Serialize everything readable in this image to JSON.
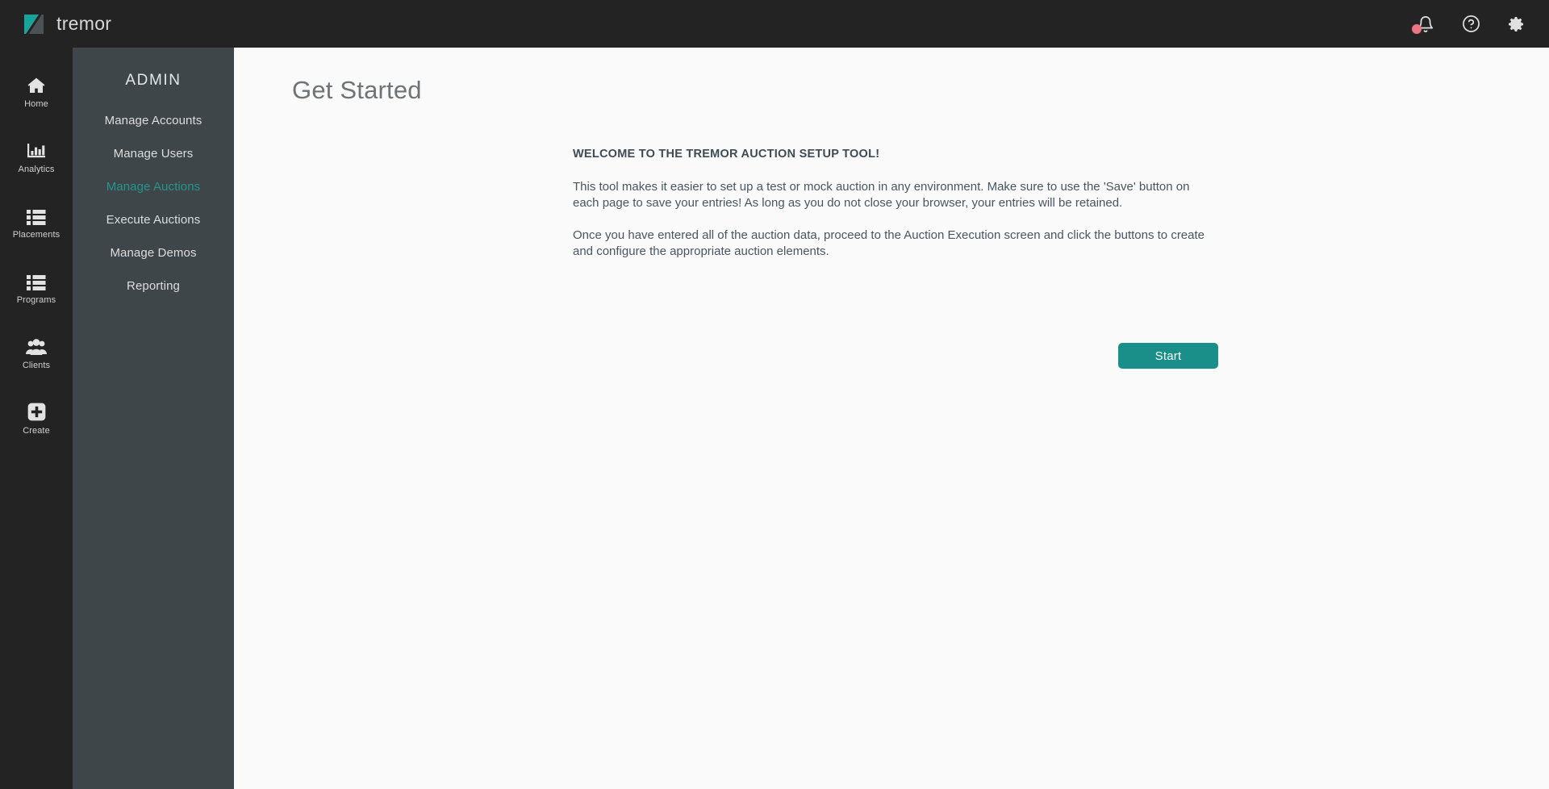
{
  "topbar": {
    "brand_name": "tremor",
    "logo_colors": {
      "teal": "#18A39B",
      "gray": "#4A5255"
    },
    "background": "#232323",
    "icons": [
      {
        "name": "notifications-bell-icon",
        "label": "Notifications",
        "badge": true,
        "badge_color": "#ef7484"
      },
      {
        "name": "help-circle-icon",
        "label": "Help"
      },
      {
        "name": "gear-icon",
        "label": "Settings"
      }
    ]
  },
  "rail": {
    "background": "#232323",
    "items": [
      {
        "label": "Home",
        "icon": "home-icon"
      },
      {
        "label": "Analytics",
        "icon": "analytics-bar-chart-icon"
      },
      {
        "label": "Placements",
        "icon": "list-icon"
      },
      {
        "label": "Programs",
        "icon": "list-icon"
      },
      {
        "label": "Clients",
        "icon": "people-group-icon"
      },
      {
        "label": "Create",
        "icon": "plus-square-icon"
      }
    ]
  },
  "admin": {
    "title": "ADMIN",
    "background": "#3e4649",
    "active_color": "#23968f",
    "items": [
      {
        "label": "Manage Accounts",
        "active": false
      },
      {
        "label": "Manage Users",
        "active": false
      },
      {
        "label": "Manage Auctions",
        "active": true
      },
      {
        "label": "Execute Auctions",
        "active": false
      },
      {
        "label": "Manage Demos",
        "active": false
      },
      {
        "label": "Reporting",
        "active": false
      }
    ]
  },
  "main": {
    "page_title": "Get Started",
    "welcome_heading": "WELCOME TO THE TREMOR AUCTION SETUP TOOL!",
    "paragraph_1": "This tool makes it easier to set up a test or mock auction in any environment. Make sure to use the 'Save' button on each page to save your entries! As long as you do not close your browser, your entries will be retained.",
    "paragraph_2": "Once you have entered all of the auction data, proceed to the Auction Execution screen and click the buttons to create and configure the appropriate auction elements.",
    "start_button": "Start",
    "start_button_color": "#1a8f8a"
  }
}
